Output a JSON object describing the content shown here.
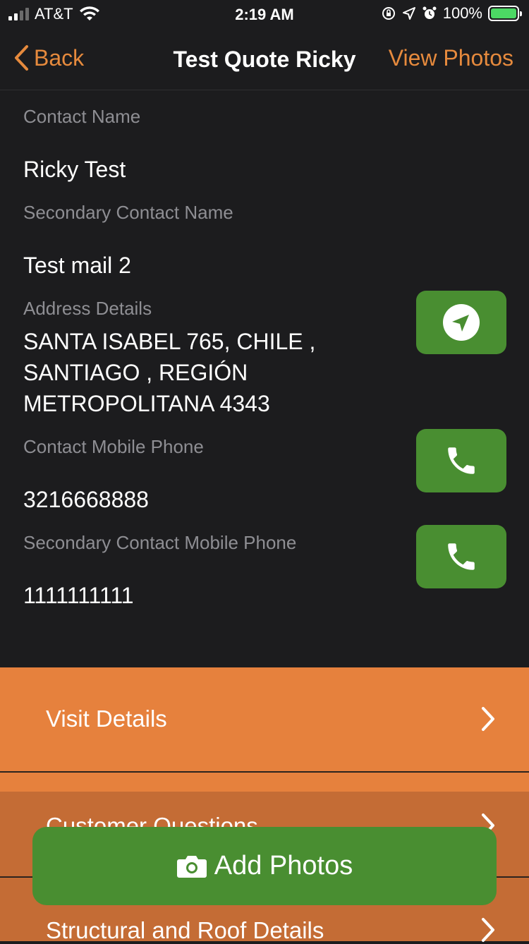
{
  "status_bar": {
    "carrier": "AT&T",
    "time": "2:19 AM",
    "battery": "100%",
    "icons": [
      "signal-icon",
      "wifi-icon",
      "orientation-lock-icon",
      "location-icon",
      "alarm-icon",
      "battery-charging-icon"
    ]
  },
  "nav": {
    "back_label": "Back",
    "title": "Test Quote Ricky",
    "right_label": "View Photos"
  },
  "fields": {
    "contact_name_label": "Contact Name",
    "contact_name_value": "Ricky Test",
    "secondary_name_label": "Secondary Contact Name",
    "secondary_name_value": "Test mail 2",
    "address_label": "Address Details",
    "address_value": "SANTA ISABEL 765, CHILE , SANTIAGO , REGIÓN METROPOLITANA 4343",
    "mobile_label": "Contact Mobile Phone",
    "mobile_value": "3216668888",
    "secondary_mobile_label": "Secondary Contact Mobile Phone",
    "secondary_mobile_value": "1111111111"
  },
  "menu": {
    "items": [
      {
        "label": "Visit Details"
      },
      {
        "label": "Customer Questions"
      },
      {
        "label": "Structural and Roof Details"
      }
    ]
  },
  "add_photos": {
    "label": "Add Photos"
  },
  "colors": {
    "accent": "#e68a3d",
    "menu_primary": "#e6813d",
    "menu_secondary": "#c46c35",
    "button_green": "#498e31",
    "background": "#1c1c1e"
  }
}
